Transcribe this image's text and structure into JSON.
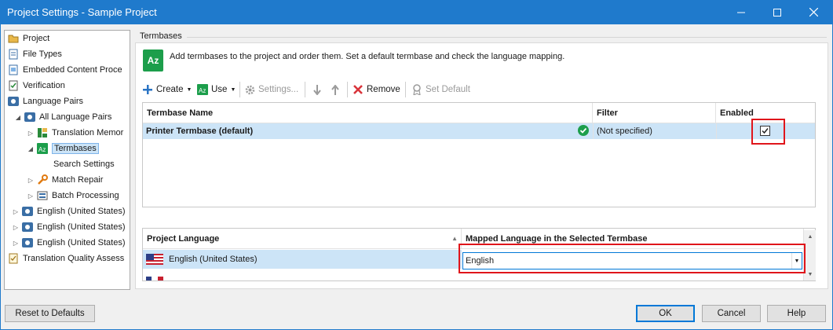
{
  "window": {
    "title": "Project Settings - Sample Project"
  },
  "tree": {
    "items": [
      {
        "label": "Project",
        "icon": "project-icon"
      },
      {
        "label": "File Types",
        "icon": "file-types-icon"
      },
      {
        "label": "Embedded Content Proce",
        "icon": "embedded-content-icon"
      },
      {
        "label": "Verification",
        "icon": "verification-icon"
      },
      {
        "label": "Language Pairs",
        "icon": "language-pairs-icon"
      },
      {
        "label": "All Language Pairs",
        "icon": "language-pair-icon"
      },
      {
        "label": "Translation Memor",
        "icon": "translation-memory-icon"
      },
      {
        "label": "Termbases",
        "icon": "termbase-icon"
      },
      {
        "label": "Search Settings",
        "icon": ""
      },
      {
        "label": "Match Repair",
        "icon": "wrench-icon"
      },
      {
        "label": "Batch Processing",
        "icon": "batch-processing-icon"
      },
      {
        "label": "English (United States)",
        "icon": "language-pair-icon"
      },
      {
        "label": "English (United States)",
        "icon": "language-pair-icon"
      },
      {
        "label": "English (United States)",
        "icon": "language-pair-icon"
      },
      {
        "label": "Translation Quality Assess",
        "icon": "tqa-icon"
      }
    ]
  },
  "panel": {
    "group_label": "Termbases",
    "intro": "Add termbases to the project and order them. Set a default termbase and check the language mapping.",
    "intro_icon_text": "Az"
  },
  "toolbar": {
    "create": "Create",
    "use": "Use",
    "settings": "Settings...",
    "remove": "Remove",
    "set_default": "Set Default"
  },
  "termbase_grid": {
    "columns": [
      "Termbase Name",
      "Filter",
      "Enabled"
    ],
    "rows": [
      {
        "name": "Printer Termbase (default)",
        "filter": "(Not specified)",
        "enabled": true
      }
    ]
  },
  "mapping_grid": {
    "columns": [
      "Project Language",
      "Mapped Language in the Selected Termbase"
    ],
    "rows": [
      {
        "language": "English (United States)",
        "mapped": "English"
      }
    ]
  },
  "buttons": {
    "reset": "Reset to Defaults",
    "ok": "OK",
    "cancel": "Cancel",
    "help": "Help"
  },
  "colors": {
    "titlebar": "#1f7acc",
    "selection": "#cce4f7",
    "highlight_box": "#e0151b",
    "termbase_green": "#1c9e4b"
  }
}
